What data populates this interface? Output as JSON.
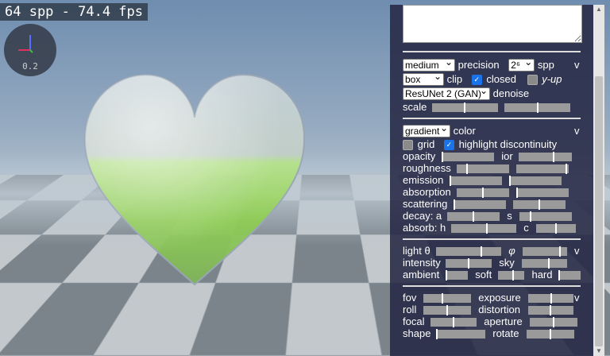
{
  "hud": {
    "fps_text": "64 spp - 74.4 fps",
    "gizmo_value": "0.2"
  },
  "panel": {
    "render": {
      "precision_select": "medium",
      "precision_label": "precision",
      "spp_select": "2⁶",
      "spp_label": "spp",
      "clip_select": "box",
      "clip_label": "clip",
      "closed_label": "closed",
      "closed_checked": true,
      "yup_label": "y-up",
      "yup_checked": false,
      "denoise_select": "ResUNet 2 (GAN)",
      "denoise_label": "denoise",
      "scale_label": "scale",
      "toggle": "v"
    },
    "material": {
      "color_select": "gradient",
      "color_label": "color",
      "grid_label": "grid",
      "grid_checked": false,
      "highlight_label": "highlight discontinuity",
      "highlight_checked": true,
      "opacity_label": "opacity",
      "ior_label": "ior",
      "roughness_label": "roughness",
      "emission_label": "emission",
      "absorption_label": "absorption",
      "scattering_label": "scattering",
      "decay_label": "decay: a",
      "decay_s_label": "s",
      "absorb_label": "absorb: h",
      "absorb_c_label": "c",
      "toggle": "v"
    },
    "light": {
      "theta_label": "light θ",
      "phi_label": "φ",
      "intensity_label": "intensity",
      "sky_label": "sky",
      "ambient_label": "ambient",
      "soft_label": "soft",
      "hard_label": "hard",
      "toggle": "v"
    },
    "camera": {
      "fov_label": "fov",
      "exposure_label": "exposure",
      "roll_label": "roll",
      "distortion_label": "distortion",
      "focal_label": "focal",
      "aperture_label": "aperture",
      "shape_label": "shape",
      "rotate_label": "rotate",
      "toggle": "v"
    }
  },
  "sliders": {
    "scale_1": 0.5,
    "scale_2": 0.5,
    "opacity": 0.0,
    "ior": 0.65,
    "roughness_1": 0.2,
    "roughness_2": 0.97,
    "emission_1": 0.0,
    "emission_2": 0.0,
    "absorption_1": 0.5,
    "absorption_2": 0.0,
    "scattering_1": 0.0,
    "scattering_2": 0.5,
    "decay_a": 0.5,
    "decay_s": 0.2,
    "absorb_h": 0.55,
    "absorb_c": 0.5,
    "light_theta": 0.7,
    "light_phi": 0.85,
    "intensity": 0.5,
    "sky": 0.6,
    "ambient": 0.0,
    "soft": 0.6,
    "hard": 0.0,
    "fov": 0.4,
    "exposure": 0.5,
    "roll": 0.5,
    "distortion": 0.5,
    "focal": 0.5,
    "aperture": 0.5,
    "shape": 0.0,
    "rotate": 0.5
  },
  "colors": {
    "panel_bg": "#26284488",
    "accent_check": "#1a73e8"
  }
}
